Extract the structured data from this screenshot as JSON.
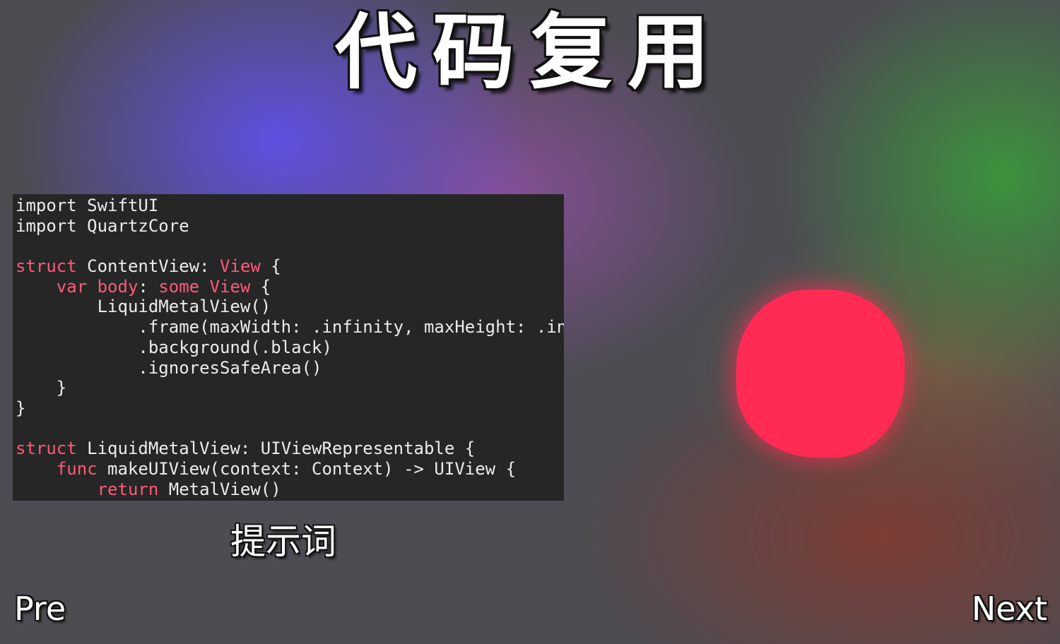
{
  "title": "代码复用",
  "code": {
    "lines": [
      [
        {
          "t": "import SwiftUI"
        }
      ],
      [
        {
          "t": "import QuartzCore"
        }
      ],
      [
        {
          "t": ""
        }
      ],
      [
        {
          "t": "struct",
          "k": true
        },
        {
          "t": " ContentView: "
        },
        {
          "t": "View",
          "k": true
        },
        {
          "t": " {"
        }
      ],
      [
        {
          "t": "    "
        },
        {
          "t": "var",
          "k": true
        },
        {
          "t": " "
        },
        {
          "t": "body",
          "k": true
        },
        {
          "t": ": "
        },
        {
          "t": "some",
          "k": true
        },
        {
          "t": " "
        },
        {
          "t": "View",
          "k": true
        },
        {
          "t": " {"
        }
      ],
      [
        {
          "t": "        LiquidMetalView()"
        }
      ],
      [
        {
          "t": "            .frame(maxWidth: .infinity, maxHeight: .infinity)"
        }
      ],
      [
        {
          "t": "            .background(.black)"
        }
      ],
      [
        {
          "t": "            .ignoresSafeArea()"
        }
      ],
      [
        {
          "t": "    }"
        }
      ],
      [
        {
          "t": "}"
        }
      ],
      [
        {
          "t": ""
        }
      ],
      [
        {
          "t": "struct",
          "k": true
        },
        {
          "t": " LiquidMetalView: UIViewRepresentable {"
        }
      ],
      [
        {
          "t": "    "
        },
        {
          "t": "func",
          "k": true
        },
        {
          "t": " makeUIView(context: Context) -> UIView {"
        }
      ],
      [
        {
          "t": "        "
        },
        {
          "t": "return",
          "k": true
        },
        {
          "t": " MetalView()"
        }
      ]
    ]
  },
  "prompt_label": "提示词",
  "nav": {
    "pre_label": "Pre",
    "next_label": "Next"
  },
  "colors": {
    "keyword": "#ff5a78",
    "code_text": "#ececec",
    "code_background": "#262627",
    "blob": "#ff2b55"
  }
}
